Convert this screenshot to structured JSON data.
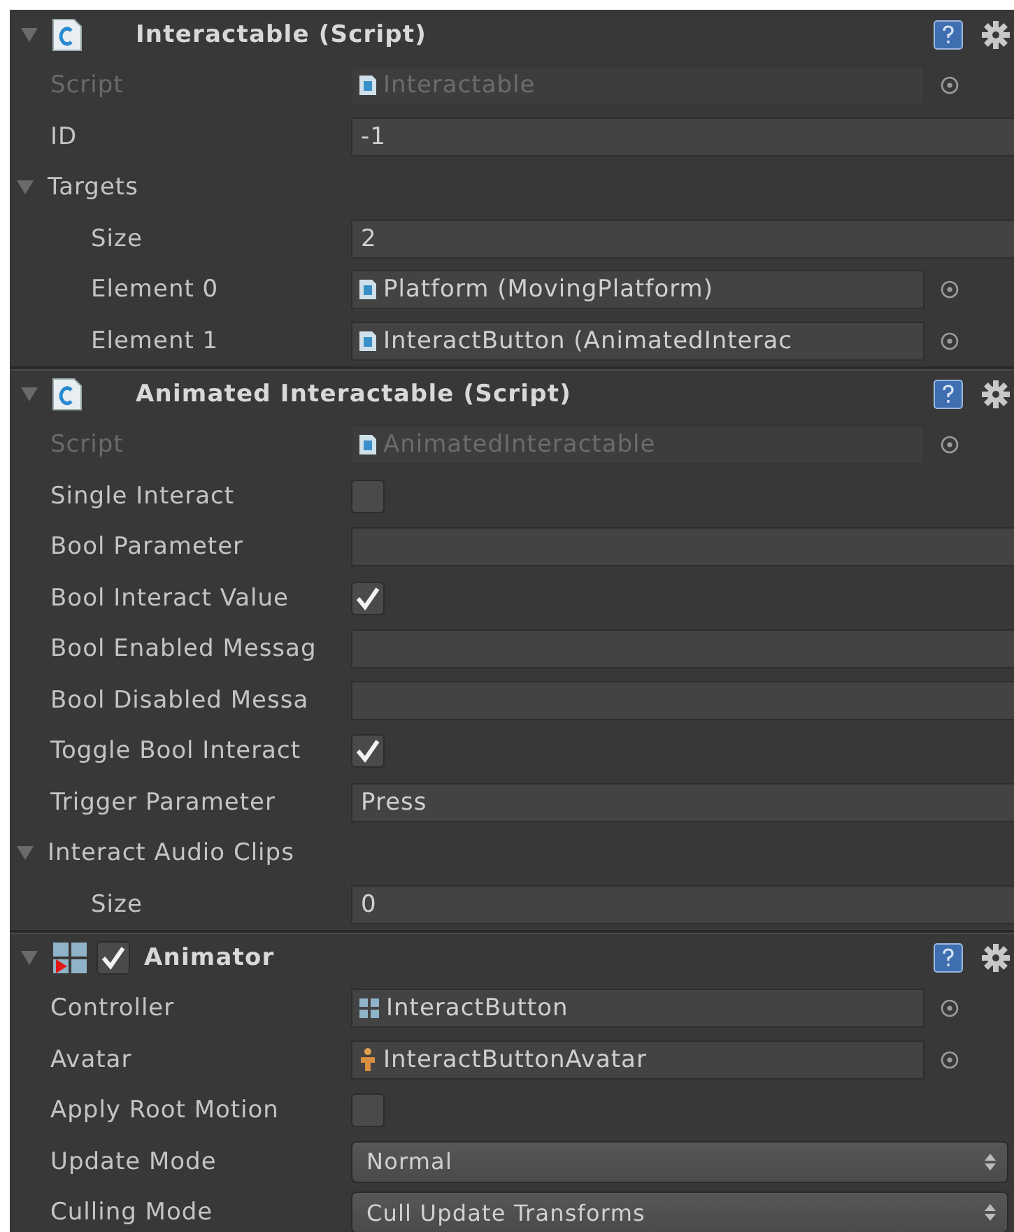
{
  "components": [
    {
      "kind": "script",
      "title": "Interactable (Script)",
      "expanded": true,
      "rows": [
        {
          "kind": "script_ref",
          "label": "Script",
          "value": "Interactable",
          "disabled": true
        },
        {
          "kind": "text",
          "label": "ID",
          "value": "-1",
          "disabled": false
        },
        {
          "kind": "foldout",
          "label": "Targets",
          "expanded": true,
          "children": [
            {
              "kind": "text",
              "label": "Size",
              "value": "2",
              "disabled": false
            },
            {
              "kind": "script_ref",
              "label": "Element 0",
              "value": "Platform (MovingPlatform)",
              "disabled": false
            },
            {
              "kind": "script_ref",
              "label": "Element 1",
              "value": "InteractButton (AnimatedInterac",
              "disabled": false
            }
          ]
        }
      ]
    },
    {
      "kind": "script",
      "title": "Animated Interactable (Script)",
      "expanded": true,
      "rows": [
        {
          "kind": "script_ref",
          "label": "Script",
          "value": "AnimatedInteractable",
          "disabled": true
        },
        {
          "kind": "checkbox",
          "label": "Single Interact",
          "checked": false,
          "disabled": false
        },
        {
          "kind": "text",
          "label": "Bool Parameter",
          "value": "",
          "disabled": false
        },
        {
          "kind": "checkbox",
          "label": "Bool Interact Value",
          "checked": true,
          "disabled": false
        },
        {
          "kind": "text",
          "label": "Bool Enabled Messag",
          "value": "",
          "disabled": false
        },
        {
          "kind": "text",
          "label": "Bool Disabled Messa",
          "value": "",
          "disabled": false
        },
        {
          "kind": "checkbox",
          "label": "Toggle Bool Interact",
          "checked": true,
          "disabled": false
        },
        {
          "kind": "text",
          "label": "Trigger Parameter",
          "value": "Press",
          "disabled": false
        },
        {
          "kind": "foldout",
          "label": "Interact Audio Clips",
          "expanded": true,
          "children": [
            {
              "kind": "text",
              "label": "Size",
              "value": "0",
              "disabled": false
            }
          ]
        }
      ]
    },
    {
      "kind": "animator",
      "title": "Animator",
      "expanded": true,
      "enabled": true,
      "rows": [
        {
          "kind": "controller_ref",
          "label": "Controller",
          "value": "InteractButton",
          "disabled": false
        },
        {
          "kind": "avatar_ref",
          "label": "Avatar",
          "value": "InteractButtonAvatar",
          "disabled": false
        },
        {
          "kind": "checkbox",
          "label": "Apply Root Motion",
          "checked": false,
          "disabled": false
        },
        {
          "kind": "enum",
          "label": "Update Mode",
          "value": "Normal",
          "disabled": false
        },
        {
          "kind": "enum",
          "label": "Culling Mode",
          "value": "Cull Update Transforms",
          "disabled": false
        }
      ]
    }
  ]
}
